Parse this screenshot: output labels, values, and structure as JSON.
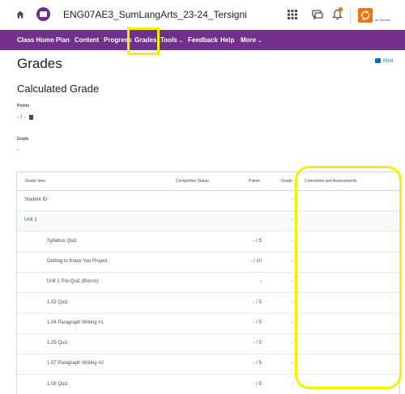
{
  "header": {
    "course_title": "ENG07AE3_SumLangArts_23-24_Tersigni",
    "role_text": "as Student"
  },
  "nav": {
    "items": [
      {
        "label": "Class Home",
        "has_menu": false
      },
      {
        "label": "Plan",
        "has_menu": false
      },
      {
        "label": "Content",
        "has_menu": false
      },
      {
        "label": "Progress",
        "has_menu": false
      },
      {
        "label": "Grades",
        "has_menu": false
      },
      {
        "label": "Tools",
        "has_menu": true
      },
      {
        "label": "Feedback",
        "has_menu": false
      },
      {
        "label": "Help",
        "has_menu": false
      },
      {
        "label": "More",
        "has_menu": true
      }
    ],
    "active": "Grades",
    "chevron": "⌄"
  },
  "page": {
    "title": "Grades",
    "print_label": "Print",
    "section_title": "Calculated Grade",
    "points_label": "Points",
    "points_value": "- / -",
    "grade_label": "Grade",
    "grade_value": "-"
  },
  "table": {
    "headers": {
      "item": "Grade Item",
      "completion": "Completion Status",
      "points": "Points",
      "grade": "Grade",
      "comments": "Comments and Assessments"
    },
    "rows": [
      {
        "item": "Student ID",
        "points": "",
        "grade": "-",
        "indent": 0,
        "shaded": false
      },
      {
        "item": "Unit 1",
        "points": "",
        "grade": "-",
        "indent": 0,
        "shaded": true
      },
      {
        "item": "Syllabus Quiz",
        "points": "- / 5",
        "grade": "-",
        "indent": 1,
        "shaded": false
      },
      {
        "item": "Getting to Know You Project",
        "points": "- / 10",
        "grade": "-",
        "indent": 1,
        "shaded": false
      },
      {
        "item": "Unit 1 Pre-Quiz (Bonus)",
        "points": "-",
        "grade": "-",
        "indent": 1,
        "shaded": false
      },
      {
        "item": "1.02 Quiz",
        "points": "- / 5",
        "grade": "-",
        "indent": 1,
        "shaded": false
      },
      {
        "item": "1.04 Paragraph Writing #1",
        "points": "- / 5",
        "grade": "-",
        "indent": 1,
        "shaded": false
      },
      {
        "item": "1.05 Quiz",
        "points": "- / 5",
        "grade": "-",
        "indent": 1,
        "shaded": false
      },
      {
        "item": "1.07 Paragraph Writing #2",
        "points": "- / 5",
        "grade": "-",
        "indent": 1,
        "shaded": false
      },
      {
        "item": "1.08 Quiz",
        "points": "- / 5",
        "grade": "-",
        "indent": 1,
        "shaded": false
      }
    ]
  },
  "colors": {
    "nav_bg": "#70308c",
    "highlight": "#f5f000",
    "accent_orange": "#e87511",
    "link_blue": "#006fbf"
  }
}
